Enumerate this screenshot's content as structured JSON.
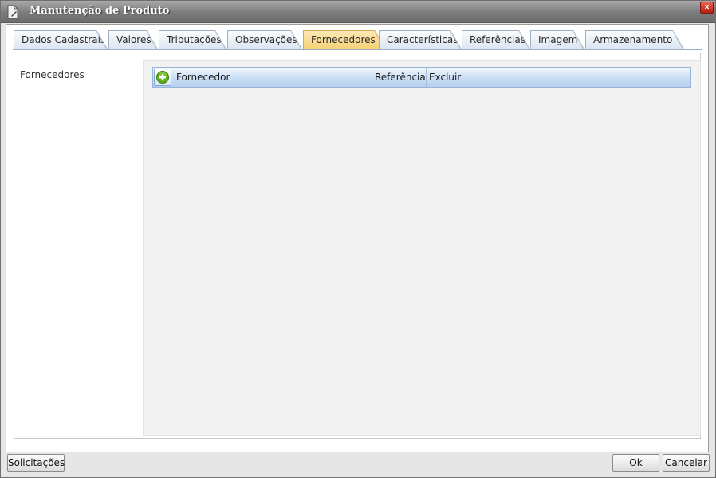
{
  "window": {
    "title": "Manutenção de Produto",
    "close_label": "x"
  },
  "tabs": [
    {
      "label": "Dados Cadastrais"
    },
    {
      "label": "Valores"
    },
    {
      "label": "Tributações"
    },
    {
      "label": "Observações"
    },
    {
      "label": "Fornecedores",
      "active": true
    },
    {
      "label": "Características"
    },
    {
      "label": "Referências"
    },
    {
      "label": "Imagem"
    },
    {
      "label": "Armazenamento"
    }
  ],
  "panel": {
    "label": "Fornecedores",
    "grid": {
      "columns": [
        "Fornecedor",
        "Referência",
        "Excluir"
      ],
      "rows": []
    }
  },
  "footer": {
    "left_button": "Solicitações",
    "ok_button": "Ok",
    "cancel_button": "Cancelar"
  },
  "colors": {
    "active_tab": "#f8cf72",
    "grid_header": "#cde0f6",
    "add_icon": "#5fae1f"
  }
}
